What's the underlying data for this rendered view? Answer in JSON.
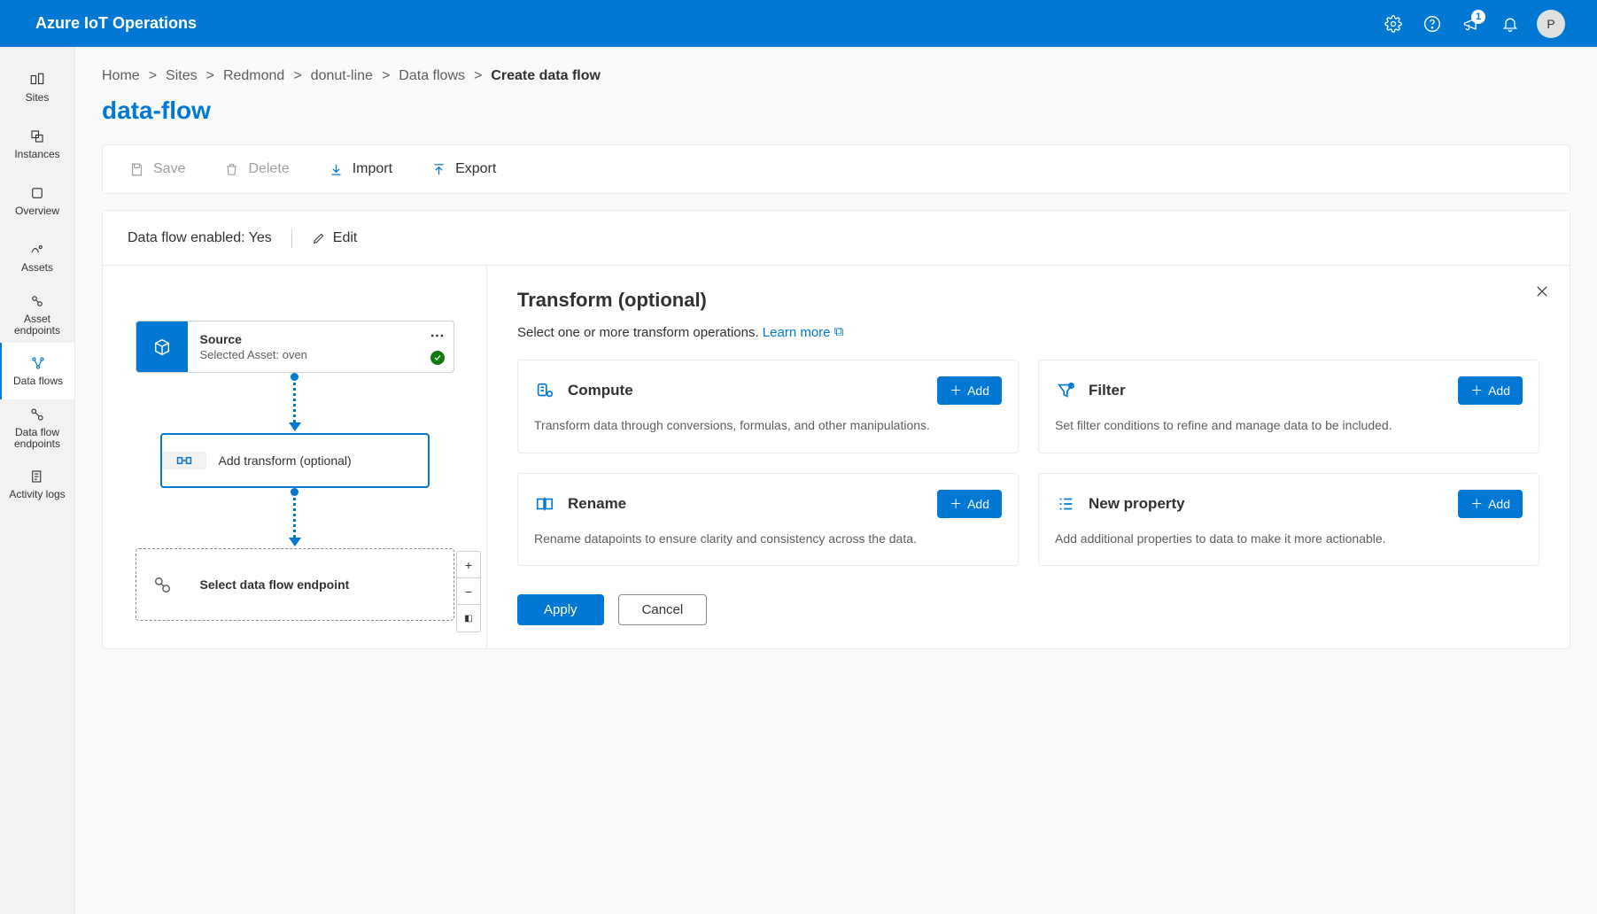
{
  "header": {
    "app_title": "Azure IoT Operations",
    "notification_badge": "1",
    "avatar_initial": "P"
  },
  "left_nav": [
    {
      "label": "Sites"
    },
    {
      "label": "Instances"
    },
    {
      "label": "Overview"
    },
    {
      "label": "Assets"
    },
    {
      "label": "Asset endpoints"
    },
    {
      "label": "Data flows"
    },
    {
      "label": "Data flow endpoints"
    },
    {
      "label": "Activity logs"
    }
  ],
  "breadcrumb": {
    "items": [
      "Home",
      "Sites",
      "Redmond",
      "donut-line",
      "Data flows"
    ],
    "current": "Create data flow"
  },
  "page_title": "data-flow",
  "commands": {
    "save": "Save",
    "delete": "Delete",
    "import": "Import",
    "export": "Export"
  },
  "status_bar": {
    "enabled_label": "Data flow enabled: Yes",
    "edit": "Edit"
  },
  "canvas": {
    "source": {
      "title": "Source",
      "subtitle": "Selected Asset: oven"
    },
    "transform": {
      "title": "Add transform (optional)"
    },
    "endpoint": {
      "title": "Select data flow endpoint"
    }
  },
  "details": {
    "title": "Transform (optional)",
    "subtitle_prefix": "Select one or more transform operations. ",
    "learn_more": "Learn more",
    "add_label": "Add",
    "apply": "Apply",
    "cancel": "Cancel",
    "cards": {
      "compute": {
        "title": "Compute",
        "desc": "Transform data through conversions, formulas, and other manipulations."
      },
      "filter": {
        "title": "Filter",
        "desc": "Set filter conditions to refine and manage data to be included."
      },
      "rename": {
        "title": "Rename",
        "desc": "Rename datapoints to ensure clarity and consistency across the data."
      },
      "newprop": {
        "title": "New property",
        "desc": "Add additional properties to data to make it more actionable."
      }
    }
  }
}
